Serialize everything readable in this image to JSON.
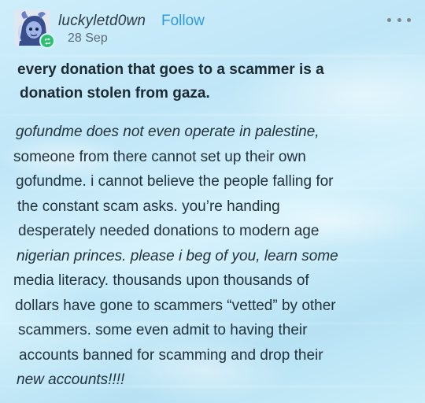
{
  "post": {
    "username": "luckyletd0wn",
    "follow_label": "Follow",
    "date": "28 Sep",
    "more_icon": "more-dots-icon",
    "title_lines": [
      "every donation that goes to a scammer is a",
      "donation stolen from gaza."
    ],
    "body_lines": [
      "gofundme does not even operate in palestine,",
      "someone from there cannot set up their own",
      "gofundme. i cannot believe the people falling for",
      "the constant scam asks. you’re handing",
      "desperately needed donations to modern age",
      "nigerian princes. please i beg of you, learn some",
      "media literacy. thousands upon thousands of",
      "dollars have gone to scammers “vetted” by other",
      "scammers. some even admit to having their",
      "accounts banned for scamming and drop their",
      "new accounts!!!!"
    ]
  },
  "colors": {
    "accent": "#2f9bd6",
    "badge": "#2fbf71",
    "text": "#22323d"
  }
}
